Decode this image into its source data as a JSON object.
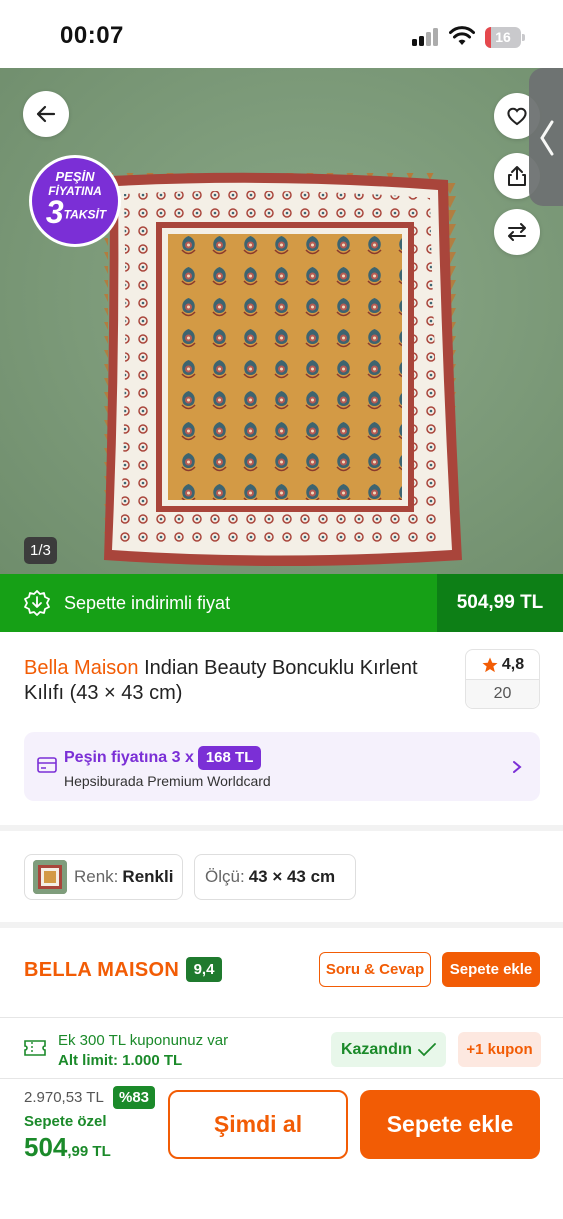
{
  "status_bar": {
    "time": "00:07",
    "battery": "16",
    "battery_color": "#e5484d"
  },
  "gallery": {
    "badge": {
      "line1": "PEŞİN",
      "line2": "FİYATINA",
      "num": "3",
      "word": "TAKSİT"
    },
    "counter": "1/3",
    "icons": [
      "back-arrow-icon",
      "heart-icon",
      "share-icon",
      "compare-icon",
      "chevron-left-icon"
    ]
  },
  "discount_bar": {
    "label": "Sepette indirimli fiyat",
    "price": "504,99 TL"
  },
  "product": {
    "brand": "Bella Maison",
    "name": " Indian Beauty Boncuklu Kırlent Kılıfı (43 × 43 cm)",
    "rating": "4,8",
    "review_count": "20"
  },
  "premium": {
    "prefix": "Peşin fiyatına 3 x",
    "amount": "168 TL",
    "card": "Hepsiburada Premium Worldcard"
  },
  "variants": {
    "color_label": "Renk:",
    "color_value": "Renkli",
    "size_label": "Ölçü:",
    "size_value": "43 × 43 cm"
  },
  "seller": {
    "name": "BELLA MAISON",
    "score": "9,4",
    "qa_label": "Soru & Cevap",
    "add_label": "Sepete ekle"
  },
  "coupon": {
    "line1": "Ek 300 TL kuponunuz var",
    "line2": "Alt limit: 1.000 TL",
    "won": "Kazandın",
    "more": "+1 kupon"
  },
  "bottom": {
    "old_price": "2.970,53 TL",
    "discount": "%83",
    "special": "Sepete özel",
    "price_int": "504",
    "price_dec": ",99 TL",
    "buy_now": "Şimdi al",
    "add_cart": "Sepete ekle"
  },
  "colors": {
    "brand_orange": "#f25c05",
    "green": "#16a016",
    "dark_green": "#0d7f16",
    "purple": "#7b2fd6"
  }
}
